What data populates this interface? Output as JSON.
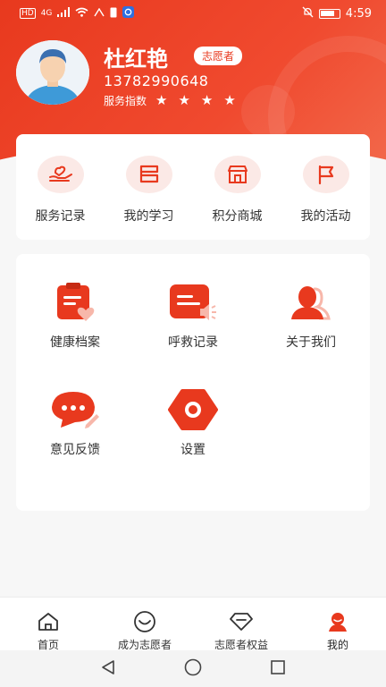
{
  "status_bar": {
    "network_label": "HD",
    "signal_label": "4G",
    "time": "4:59"
  },
  "profile": {
    "name": "杜红艳",
    "badge": "志愿者",
    "phone": "13782990648",
    "rating_label": "服务指数",
    "rating_stars": 4
  },
  "quick_actions": [
    {
      "label": "服务记录",
      "icon": "hand-heart-icon"
    },
    {
      "label": "我的学习",
      "icon": "book-icon"
    },
    {
      "label": "积分商城",
      "icon": "shop-icon"
    },
    {
      "label": "我的活动",
      "icon": "flag-icon"
    }
  ],
  "menu": [
    {
      "label": "健康档案",
      "icon": "health-record-icon"
    },
    {
      "label": "呼救记录",
      "icon": "alarm-record-icon"
    },
    {
      "label": "关于我们",
      "icon": "about-us-icon"
    },
    {
      "label": "意见反馈",
      "icon": "feedback-icon"
    },
    {
      "label": "设置",
      "icon": "settings-icon"
    }
  ],
  "bottom_nav": [
    {
      "label": "首页",
      "icon": "home-icon",
      "active": false
    },
    {
      "label": "成为志愿者",
      "icon": "smile-icon",
      "active": false
    },
    {
      "label": "志愿者权益",
      "icon": "diamond-icon",
      "active": false
    },
    {
      "label": "我的",
      "icon": "user-icon",
      "active": true
    }
  ],
  "colors": {
    "brand": "#e8391e",
    "brand_light": "#fbe9e6",
    "background": "#f7f7f7"
  }
}
